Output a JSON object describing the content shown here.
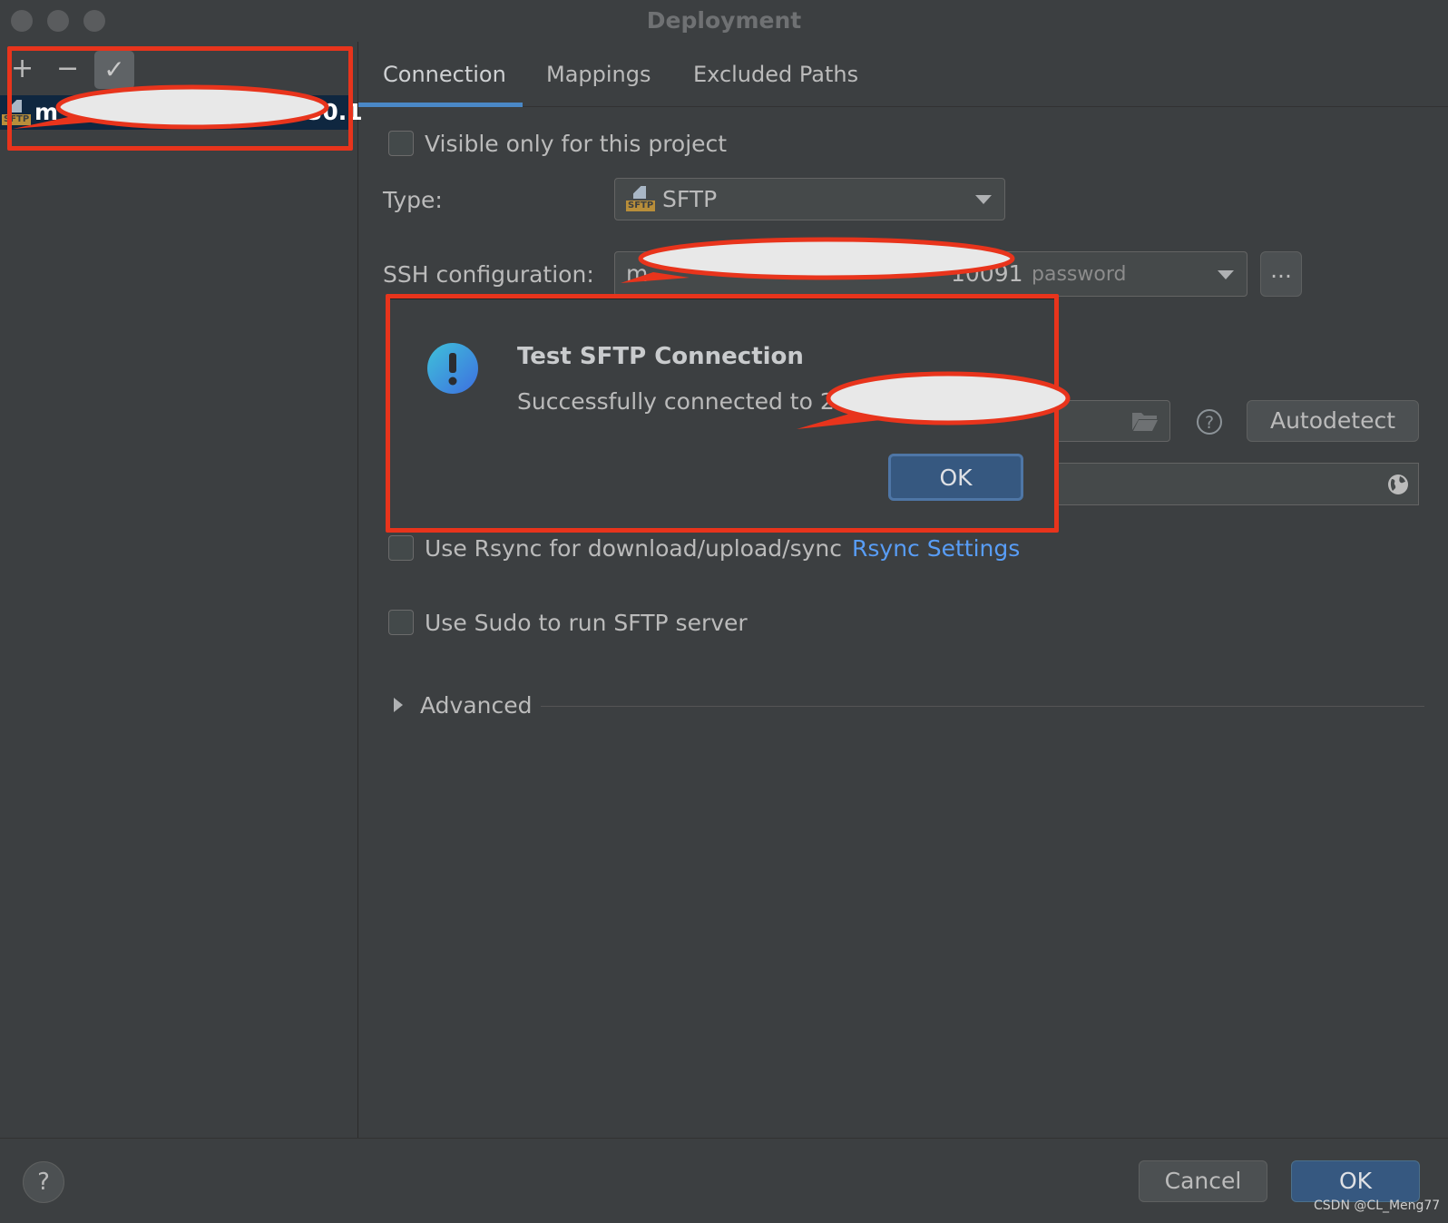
{
  "window": {
    "title": "Deployment"
  },
  "sidebar": {
    "toolbar": {
      "add_icon": "+",
      "remove_icon": "−",
      "check_icon": "✓"
    },
    "items": [
      {
        "label_start": "m",
        "label_end": "30.1",
        "type_badge": "SFTP"
      }
    ]
  },
  "tabs": [
    {
      "label": "Connection",
      "active": true
    },
    {
      "label": "Mappings"
    },
    {
      "label": "Excluded Paths"
    }
  ],
  "connection": {
    "visible_only_label": "Visible only for this project",
    "visible_only_checked": false,
    "type_label": "Type:",
    "type_value": "SFTP",
    "type_badge": "SFTP",
    "ssh_label": "SSH configuration:",
    "ssh_value_start": "m",
    "ssh_value_end": "10091",
    "ssh_auth": "password",
    "ssh_more_button": "...",
    "autodetect_button": "Autodetect",
    "rsync_label": "Use Rsync for download/upload/sync",
    "rsync_checked": false,
    "rsync_link": "Rsync Settings",
    "sudo_label": "Use Sudo to run SFTP server",
    "sudo_checked": false,
    "advanced_label": "Advanced"
  },
  "dialog": {
    "title": "Test SFTP Connection",
    "message": "Successfully connected to 2",
    "ok_button": "OK",
    "icon": "info-exclamation-icon"
  },
  "footer": {
    "help": "?",
    "cancel": "Cancel",
    "ok": "OK"
  },
  "watermark": "CSDN @CL_Meng77",
  "colors": {
    "accent": "#4a88c7",
    "link": "#589df6",
    "default_button": "#365880",
    "annotation_red": "#e8341c"
  }
}
